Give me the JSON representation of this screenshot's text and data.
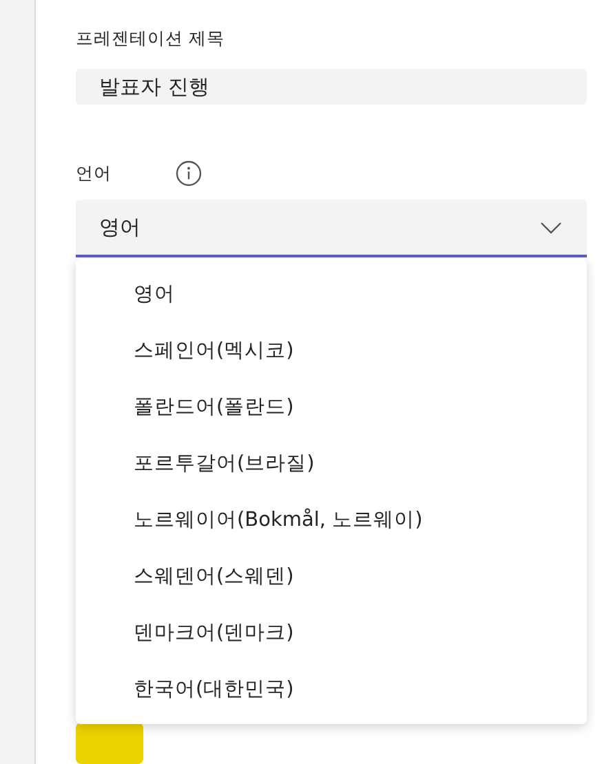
{
  "presentation_title": {
    "label": "프레젠테이션 제목",
    "value": "발표자 진행"
  },
  "language": {
    "label": "언어",
    "value": "영어",
    "expanded": true,
    "options": [
      {
        "label": "영어"
      },
      {
        "label": "스페인어(멕시코)"
      },
      {
        "label": "폴란드어(폴란드)"
      },
      {
        "label": "포르투갈어(브라질)"
      },
      {
        "label": "노르웨이어(Bokmål, 노르웨이)"
      },
      {
        "label": "스웨덴어(스웨덴)"
      },
      {
        "label": "덴마크어(덴마크)"
      },
      {
        "label": "한국어(대한민국)"
      }
    ]
  }
}
